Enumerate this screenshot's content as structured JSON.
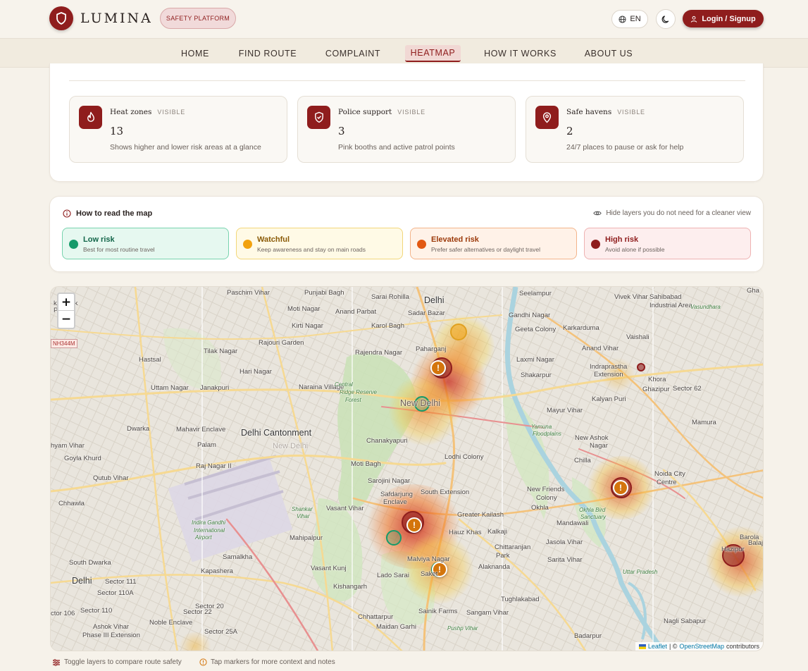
{
  "header": {
    "brand_name": "LUMINA",
    "brand_badge": "SAFETY PLATFORM",
    "language": "EN",
    "login_label": "Login / Signup"
  },
  "nav": {
    "items": [
      {
        "label": "HOME",
        "active": false
      },
      {
        "label": "FIND ROUTE",
        "active": false
      },
      {
        "label": "COMPLAINT",
        "active": false
      },
      {
        "label": "HEATMAP",
        "active": true
      },
      {
        "label": "HOW IT WORKS",
        "active": false
      },
      {
        "label": "ABOUT US",
        "active": false
      }
    ]
  },
  "stats": [
    {
      "title": "Heat zones",
      "visibility": "VISIBLE",
      "value": "13",
      "description": "Shows higher and lower risk areas at a glance",
      "icon": "flame-icon"
    },
    {
      "title": "Police support",
      "visibility": "VISIBLE",
      "value": "3",
      "description": "Pink booths and active patrol points",
      "icon": "shield-check-icon"
    },
    {
      "title": "Safe havens",
      "visibility": "VISIBLE",
      "value": "2",
      "description": "24/7 places to pause or ask for help",
      "icon": "map-pin-icon"
    }
  ],
  "legend": {
    "title": "How to read the map",
    "hint": "Hide layers you do not need for a cleaner view",
    "levels": [
      {
        "name": "Low risk",
        "description": "Best for most routine travel",
        "color": "#169a6a",
        "bg": "#e6f8f0",
        "border": "#78d3ae",
        "text": "#13664a"
      },
      {
        "name": "Watchful",
        "description": "Keep awareness and stay on main roads",
        "color": "#f2a20e",
        "bg": "#fffae6",
        "border": "#f2d77a",
        "text": "#8a5a06"
      },
      {
        "name": "Elevated risk",
        "description": "Prefer safer alternatives or daylight travel",
        "color": "#e25812",
        "bg": "#fff2e8",
        "border": "#f3b48a",
        "text": "#9c3a0b"
      },
      {
        "name": "High risk",
        "description": "Avoid alone if possible",
        "color": "#8f1d1d",
        "bg": "#fdeeee",
        "border": "#eeb2b2",
        "text": "#8f1d1d"
      }
    ]
  },
  "map": {
    "zoom_in": "+",
    "zoom_out": "−",
    "road_shield": "NH344M",
    "labels": [
      "Paschim Vihar",
      "Punjabi Bagh",
      "Sarai Rohilla",
      "Delhi",
      "Seelampur",
      "Vivek Vihar",
      "Sahibabad",
      "Industrial Area",
      "Gha",
      "k Nayak",
      "Puram",
      "Moti Nagar",
      "Anand Parbat",
      "Sadar Bazar",
      "Gandhi Nagar",
      "Geeta Colony",
      "Karkarduma",
      "Vasundhara",
      "Kirti Nagar",
      "Karol Bagh",
      "Rajouri Garden",
      "Tilak Nagar",
      "Rajendra Nagar",
      "Paharganj",
      "Anand Vihar",
      "Vaishali",
      "Hastsal",
      "Hari Nagar",
      "Laxmi Nagar",
      "Indraprastha",
      "Extension",
      "Shakarpur",
      "Khora",
      "Uttam Nagar",
      "Janakpuri",
      "Naraina Village",
      "Central",
      "Ridge Reserve",
      "Forest",
      "New Delhi",
      "Kalyan Puri",
      "Sector 62",
      "Mayur Vihar",
      "Dwarka",
      "Mahavir Enclave",
      "Delhi Cantonment",
      "Mamura",
      "Yamuna",
      "Floodplains",
      "hyam Vihar",
      "Goyla Khurd",
      "Palam",
      "Chanakyapuri",
      "New Ashok",
      "Nagar",
      "Lodhi Colony",
      "Chilla",
      "Raj Nagar II",
      "Moti Bagh",
      "Qutub Vihar",
      "Noida City",
      "Centre",
      "Chhawla",
      "Sarojini Nagar",
      "South Extension",
      "New Friends",
      "Colony",
      "Safdarjung",
      "Enclave",
      "Vasant Vihar",
      "Shankar",
      "Vihar",
      "Okhla",
      "Greater Kailash",
      "Okhla Bird",
      "Sanctuary",
      "Indira Gandhi",
      "International",
      "Airport",
      "Mahipalpur",
      "Jasola Vihar",
      "Barola",
      "Hazipur",
      "Samalkha",
      "Chittaranjan",
      "Park",
      "South Dwarka",
      "Vasant Kunj",
      "Malviya Nagar",
      "Alaknanda",
      "Sarita Vihar",
      "Kapashera",
      "Lado Sarai",
      "Saket",
      "Sector 111",
      "Kishangarh",
      "Sector 110A",
      "Tughlakabad",
      "Sector 20",
      "ctor 106",
      "Sector 110",
      "Sector 22",
      "Sainik Farms",
      "Sangam Vihar",
      "Ashok Vihar",
      "Phase III Extension",
      "Noble Enclave",
      "Chhattarpur",
      "Maidan Garhi",
      "Badarpur",
      "Nagli Sabapur",
      "Sector 25A",
      "Balaji",
      "Uttar Pradesh",
      "Delhi",
      "Hauz Khas",
      "Pushp Vihar",
      "Ghazipur",
      "Mandawali",
      "Kalkaji"
    ],
    "attribution": {
      "leaflet": "Leaflet",
      "separator": "| ©",
      "osm": "OpenStreetMap",
      "suffix": "contributors"
    },
    "warning_glyph": "!"
  },
  "footer": {
    "hint1": "Toggle layers to compare route safety",
    "hint2": "Tap markers for more context and notes"
  }
}
